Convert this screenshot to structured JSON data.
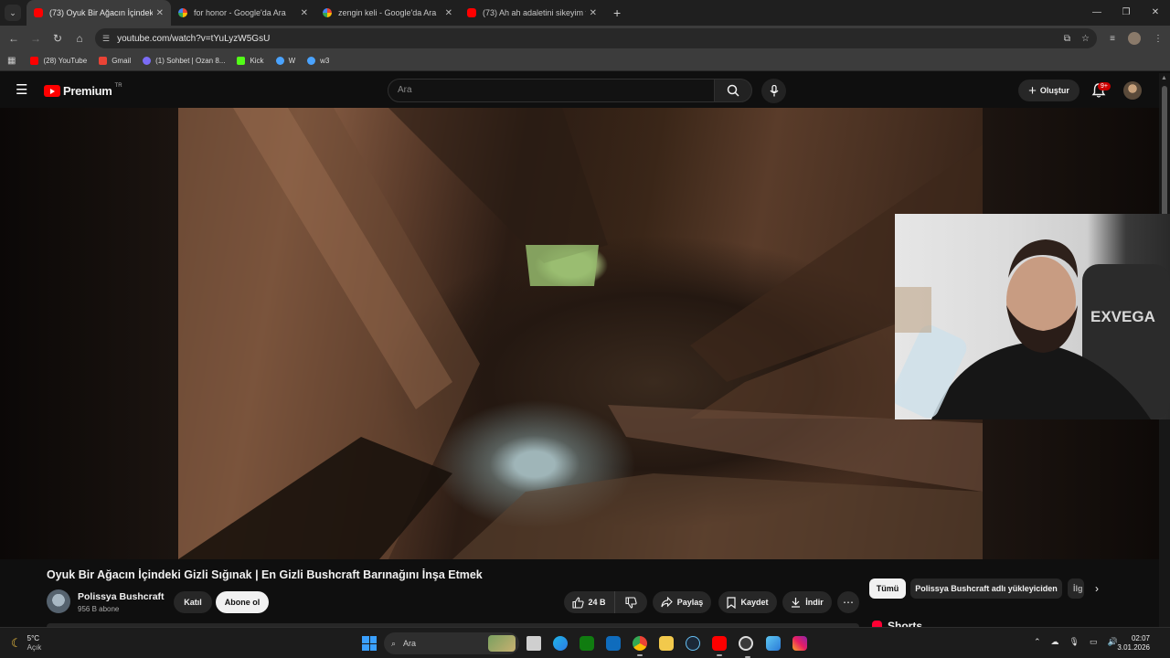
{
  "browser": {
    "tabs": [
      {
        "title": "(73) Oyuk Bir Ağacın İçindeki Gi",
        "favicon": "youtube-icon",
        "active": true
      },
      {
        "title": "for honor - Google'da Ara",
        "favicon": "google-icon",
        "active": false
      },
      {
        "title": "zengin keli - Google'da Ara",
        "favicon": "google-icon",
        "active": false
      },
      {
        "title": "(73) Ah ah adaletini sikeyim türk",
        "favicon": "youtube-icon",
        "active": false
      }
    ],
    "url": "youtube.com/watch?v=tYuLyzW5GsU",
    "bookmarks": [
      {
        "label": "(28) YouTube",
        "color": "#ff0000"
      },
      {
        "label": "Gmail",
        "color": "#ea4335"
      },
      {
        "label": "(1) Sohbet | Ozan 8...",
        "color": "#7b6cf6"
      },
      {
        "label": "Kick",
        "color": "#53fc18"
      },
      {
        "label": "W",
        "color": "#4aa3ff"
      },
      {
        "label": "w3",
        "color": "#4aa3ff"
      }
    ]
  },
  "youtube": {
    "brand": "Premium",
    "region": "TR",
    "search_placeholder": "Ara",
    "create_label": "Oluştur",
    "notification_count": "9+",
    "video": {
      "title": "Oyuk Bir Ağacın İçindeki Gizli Sığınak | En Gizli Bushcraft Barınağını İnşa Etmek",
      "channel": "Polissya Bushcraft",
      "subscribers": "956 B abone",
      "join_label": "Katıl",
      "subscribe_label": "Abone ol",
      "likes": "24 B",
      "share_label": "Paylaş",
      "save_label": "Kaydet",
      "download_label": "İndir"
    },
    "chips": [
      "Tümü",
      "Polissya Bushcraft adlı yükleyiciden",
      "İlg"
    ],
    "shorts_label": "Shorts"
  },
  "taskbar": {
    "temperature": "5°C",
    "weather": "Açık",
    "search_label": "Ara",
    "time": "02:07",
    "date": "3.01.2026"
  }
}
